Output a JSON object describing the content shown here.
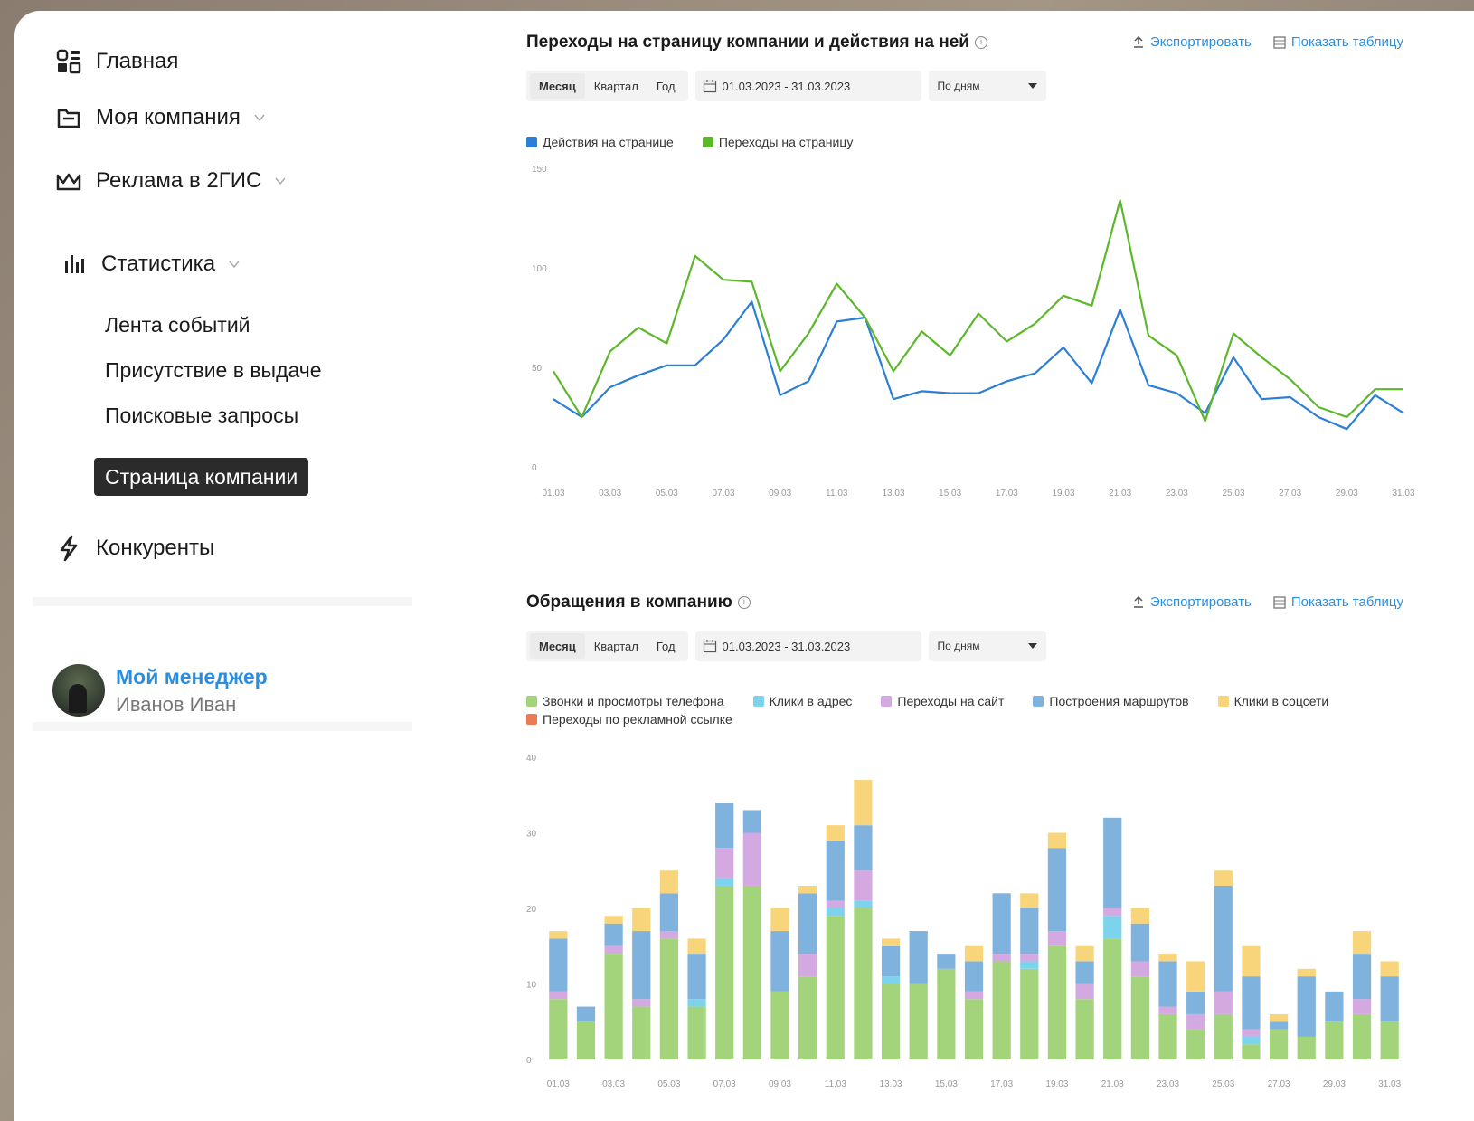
{
  "sidebar": {
    "items": [
      {
        "label": "Главная"
      },
      {
        "label": "Моя компания"
      },
      {
        "label": "Реклама в 2ГИС"
      },
      {
        "label": "Статистика"
      }
    ],
    "sub_items": [
      {
        "label": "Лента событий"
      },
      {
        "label": "Присутствие в выдаче"
      },
      {
        "label": "Поисковые запросы"
      }
    ],
    "active_sub_item": "Страница компании",
    "competitors": "Конкуренты",
    "manager": {
      "title": "Мой менеджер",
      "name": "Иванов Иван"
    }
  },
  "card1": {
    "title": "Переходы на страницу компании и действия на ней",
    "export_label": "Экспортировать",
    "table_label": "Показать таблицу",
    "tabs": [
      "Месяц",
      "Квартал",
      "Год"
    ],
    "date_range": "01.03.2023 - 31.03.2023",
    "granularity": "По дням"
  },
  "card2": {
    "title": "Обращения в компанию",
    "export_label": "Экспортировать",
    "table_label": "Показать таблицу",
    "tabs": [
      "Месяц",
      "Квартал",
      "Год"
    ],
    "date_range": "01.03.2023 - 31.03.2023",
    "granularity": "По дням"
  },
  "chart_data": [
    {
      "type": "line",
      "x": [
        "01.03",
        "02.03",
        "03.03",
        "04.03",
        "05.03",
        "06.03",
        "07.03",
        "08.03",
        "09.03",
        "10.03",
        "11.03",
        "12.03",
        "13.03",
        "14.03",
        "15.03",
        "16.03",
        "17.03",
        "18.03",
        "19.03",
        "20.03",
        "21.03",
        "22.03",
        "23.03",
        "24.03",
        "25.03",
        "26.03",
        "27.03",
        "28.03",
        "29.03",
        "30.03",
        "31.03"
      ],
      "xtick_labels": [
        "01.03",
        "03.03",
        "05.03",
        "07.03",
        "09.03",
        "11.03",
        "13.03",
        "15.03",
        "17.03",
        "19.03",
        "21.03",
        "23.03",
        "25.03",
        "27.03",
        "29.03",
        "31.03"
      ],
      "ylim": [
        0,
        150
      ],
      "yticks": [
        "0",
        "50",
        "100",
        "150"
      ],
      "grid": false,
      "legend_position": "top-left",
      "series": [
        {
          "name": "Действия на странице",
          "color": "#2b7fd6",
          "values": [
            34,
            25,
            40,
            46,
            51,
            51,
            64,
            83,
            36,
            43,
            73,
            75,
            34,
            38,
            37,
            37,
            43,
            47,
            60,
            42,
            79,
            41,
            37,
            27,
            55,
            34,
            35,
            25,
            19,
            36,
            27
          ]
        },
        {
          "name": "Переходы на страницу",
          "color": "#5cb82a",
          "values": [
            48,
            25,
            58,
            70,
            62,
            106,
            94,
            93,
            48,
            67,
            92,
            75,
            48,
            68,
            56,
            77,
            63,
            72,
            86,
            81,
            134,
            66,
            56,
            23,
            67,
            55,
            44,
            30,
            25,
            39,
            39
          ]
        }
      ]
    },
    {
      "type": "bar",
      "stacked": true,
      "categories": [
        "01.03",
        "02.03",
        "03.03",
        "04.03",
        "05.03",
        "06.03",
        "07.03",
        "08.03",
        "09.03",
        "10.03",
        "11.03",
        "12.03",
        "13.03",
        "14.03",
        "15.03",
        "16.03",
        "17.03",
        "18.03",
        "19.03",
        "20.03",
        "21.03",
        "22.03",
        "23.03",
        "24.03",
        "25.03",
        "26.03",
        "27.03",
        "28.03",
        "29.03",
        "30.03",
        "31.03"
      ],
      "xtick_labels": [
        "01.03",
        "03.03",
        "05.03",
        "07.03",
        "09.03",
        "11.03",
        "13.03",
        "15.03",
        "17.03",
        "19.03",
        "21.03",
        "23.03",
        "25.03",
        "27.03",
        "29.03",
        "31.03"
      ],
      "ylim": [
        0,
        40
      ],
      "yticks": [
        "0",
        "10",
        "20",
        "30",
        "40"
      ],
      "grid": false,
      "legend_position": "top-left",
      "series": [
        {
          "name": "Звонки и просмотры телефона",
          "color": "#a3d47c",
          "values": [
            8,
            5,
            14,
            7,
            16,
            7,
            23,
            23,
            9,
            11,
            19,
            20,
            10,
            10,
            12,
            8,
            13,
            12,
            15,
            8,
            16,
            11,
            6,
            4,
            6,
            2,
            4,
            3,
            5,
            6,
            5
          ]
        },
        {
          "name": "Клики в адрес",
          "color": "#7dd3ec",
          "values": [
            0,
            0,
            0,
            0,
            0,
            1,
            1,
            0,
            0,
            0,
            1,
            1,
            1,
            0,
            0,
            0,
            0,
            1,
            0,
            0,
            3,
            0,
            0,
            0,
            0,
            1,
            0,
            0,
            0,
            0,
            0
          ]
        },
        {
          "name": "Переходы на сайт",
          "color": "#d4a8e0",
          "values": [
            1,
            0,
            1,
            1,
            1,
            0,
            4,
            7,
            0,
            3,
            1,
            4,
            0,
            0,
            0,
            1,
            1,
            1,
            2,
            2,
            1,
            2,
            1,
            2,
            3,
            1,
            0,
            0,
            0,
            2,
            0
          ]
        },
        {
          "name": "Построения маршрутов",
          "color": "#80b2de",
          "values": [
            7,
            2,
            3,
            9,
            5,
            6,
            6,
            3,
            8,
            8,
            8,
            6,
            4,
            7,
            2,
            4,
            8,
            6,
            11,
            3,
            12,
            5,
            6,
            3,
            14,
            7,
            1,
            8,
            4,
            6,
            6
          ]
        },
        {
          "name": "Клики в соцсети",
          "color": "#f8d57a",
          "values": [
            1,
            0,
            1,
            3,
            3,
            2,
            0,
            0,
            3,
            1,
            2,
            6,
            1,
            0,
            0,
            2,
            0,
            2,
            2,
            2,
            0,
            2,
            1,
            4,
            2,
            4,
            1,
            1,
            0,
            3,
            2
          ]
        },
        {
          "name": "Переходы по рекламной ссылке",
          "color": "#ee7a50",
          "values": [
            0,
            0,
            0,
            0,
            0,
            0,
            0,
            0,
            0,
            0,
            0,
            0,
            0,
            0,
            0,
            0,
            0,
            0,
            0,
            0,
            0,
            0,
            0,
            0,
            0,
            0,
            0,
            0,
            0,
            0,
            0
          ]
        }
      ]
    }
  ]
}
